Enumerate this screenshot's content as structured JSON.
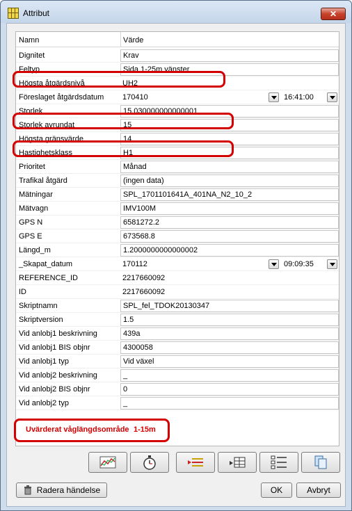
{
  "window": {
    "title": "Attribut",
    "close_glyph": "✕"
  },
  "grid": {
    "headers": {
      "name": "Namn",
      "value": "Värde"
    },
    "rows": [
      {
        "label": "Dignitet",
        "value": "Krav"
      },
      {
        "label": "Feltyp",
        "value": "Sida 1-25m vänster"
      },
      {
        "label": "Högsta åtgärdsnivå",
        "value": "UH2"
      },
      {
        "label": "Föreslaget åtgärdsdatum",
        "value": "170410",
        "time": "16:41:00"
      },
      {
        "label": "Storlek",
        "value": "15.030000000000001"
      },
      {
        "label": "Storlek avrundat",
        "value": "15"
      },
      {
        "label": "Högsta gränsvärde",
        "value": "14"
      },
      {
        "label": "Hastighetsklass",
        "value": "H1"
      },
      {
        "label": "Prioritet",
        "value": "Månad"
      },
      {
        "label": "Trafikal åtgärd",
        "value": "(ingen data)"
      },
      {
        "label": "Mätningar",
        "value": "SPL_1701101641A_401NA_N2_10_2"
      },
      {
        "label": "Mätvagn",
        "value": "IMV100M"
      },
      {
        "label": "GPS N",
        "value": "6581272.2"
      },
      {
        "label": "GPS E",
        "value": "673568.8"
      },
      {
        "label": "Längd_m",
        "value": "1.2000000000000002"
      },
      {
        "label": "_Skapat_datum",
        "value": "170112",
        "time": "09:09:35"
      },
      {
        "label": "REFERENCE_ID",
        "value": "2217660092"
      },
      {
        "label": "ID",
        "value": "2217660092"
      },
      {
        "label": "Skriptnamn",
        "value": "SPL_fel_TDOK20130347"
      },
      {
        "label": "Skriptversion",
        "value": "1.5"
      },
      {
        "label": "Vid anlobj1 beskrivning",
        "value": "439a"
      },
      {
        "label": "Vid anlobj1 BIS objnr",
        "value": "4300058"
      },
      {
        "label": "Vid anlobj1 typ",
        "value": "Vid växel"
      },
      {
        "label": "Vid anlobj2 beskrivning",
        "value": "_"
      },
      {
        "label": "Vid anlobj2 BIS objnr",
        "value": "0"
      },
      {
        "label": "Vid anlobj2 typ",
        "value": "_"
      }
    ]
  },
  "annotation": {
    "label": "Uvärderat våglängdsområde",
    "value": "1-15m"
  },
  "buttons": {
    "delete": "Radera händelse",
    "ok": "OK",
    "cancel": "Avbryt"
  },
  "toolbar": [
    "chart-icon",
    "stopwatch-icon",
    "insert-line-icon",
    "table-insert-icon",
    "checklist-icon",
    "copy-icon"
  ],
  "colors": {
    "highlight": "#d40000",
    "annotation_text": "#d40000"
  }
}
